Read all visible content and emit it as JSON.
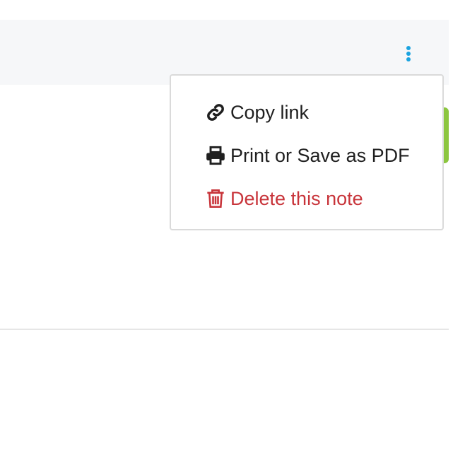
{
  "menu": {
    "items": [
      {
        "label": "Copy link",
        "icon": "link-icon"
      },
      {
        "label": "Print or Save as PDF",
        "icon": "printer-icon"
      },
      {
        "label": "Delete this note",
        "icon": "trash-icon",
        "style": "danger"
      }
    ]
  },
  "colors": {
    "accent_blue": "#1aa3e0",
    "danger_red": "#c8343a",
    "tab_green": "#8cc63f",
    "header_bg": "#f6f7f9"
  }
}
